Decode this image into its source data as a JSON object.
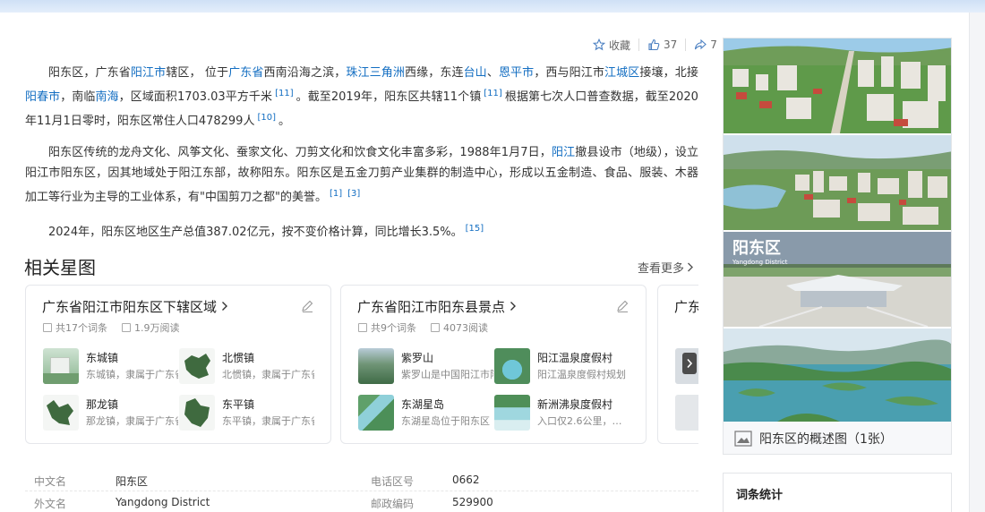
{
  "actions": {
    "favorite_label": "收藏",
    "like_count": "37",
    "share_count": "7"
  },
  "intro": {
    "p1": {
      "t1": "阳东区，广东省",
      "l1": "阳江市",
      "t2": "辖区， 位于",
      "l2": "广东省",
      "t3": "西南沿海之滨，",
      "l3": "珠江三角洲",
      "t4": "西缘，东连",
      "l4": "台山",
      "t5": "、",
      "l5": "恩平市",
      "t6": "，西与阳江市",
      "l6": "江城区",
      "t7": "接壤，北接",
      "l7": "阳春市",
      "t8": "，南临",
      "l8": "南海",
      "t9": "，区域面积1703.03平方千米",
      "r1": "[11]",
      "t10": "。截至2019年，阳东区共辖11个镇",
      "r2": "[11]",
      "t11": "根据第七次人口普查数据，截至2020年11月1日零时，阳东区常住人口478299人",
      "r3": "[10]",
      "t12": "。"
    },
    "p2": {
      "t1": "阳东区传统的龙舟文化、风筝文化、蚕家文化、刀剪文化和饮食文化丰富多彩，1988年1月7日，",
      "l1": "阳江",
      "t2": "撤县设市（地级），设立阳江市阳东区，因其地域处于阳江东部，故称阳东。阳东区是五金刀剪产业集群的制造中心，形成以五金制造、食品、服装、木器加工等行业为主导的工业体系，有\"中国剪刀之都\"的美誉。",
      "r1": "[1]",
      "r2": "[3]"
    },
    "p3": {
      "t1": "2024年，阳东区地区生产总值387.02亿元，按不变价格计算，同比增长3.5%。",
      "r1": "[15]"
    }
  },
  "section": {
    "title": "相关星图",
    "more_label": "查看更多"
  },
  "cards": [
    {
      "title": "广东省阳江市阳东区下辖区域",
      "entries": "共17个词条",
      "reads": "1.9万阅读",
      "items": [
        {
          "name": "东城镇",
          "desc": "东城镇，隶属于广东省阳江市阳东区"
        },
        {
          "name": "北惯镇",
          "desc": "北惯镇，隶属于广东省阳江市"
        },
        {
          "name": "那龙镇",
          "desc": "那龙镇，隶属于广东省阳江市"
        },
        {
          "name": "东平镇",
          "desc": "东平镇，隶属于广东省阳江市"
        }
      ]
    },
    {
      "title": "广东省阳江市阳东县景点",
      "entries": "共9个词条",
      "reads": "4073阅读",
      "items": [
        {
          "name": "紫罗山",
          "desc": "紫罗山是中国阳江市阳东区"
        },
        {
          "name": "阳江温泉度假村",
          "desc": "阳江温泉度假村规划"
        },
        {
          "name": "东湖星岛",
          "desc": "东湖星岛位于阳东区"
        },
        {
          "name": "新洲沸泉度假村",
          "desc": "入口仅2.6公里，…"
        }
      ]
    },
    {
      "title": "广东",
      "entries": "",
      "reads": ""
    }
  ],
  "info": {
    "rows": [
      {
        "k1": "中文名",
        "v1": "阳东区",
        "k2": "电话区号",
        "v2": "0662"
      },
      {
        "k1": "外文名",
        "v1": "Yangdong District",
        "k2": "邮政编码",
        "v2": "529900"
      }
    ]
  },
  "gallery": {
    "caption": "阳东区的概述图（1张）",
    "stamp_title": "阳东区",
    "stamp_sub": "Yangdong District"
  },
  "stats": {
    "title": "词条统计"
  }
}
